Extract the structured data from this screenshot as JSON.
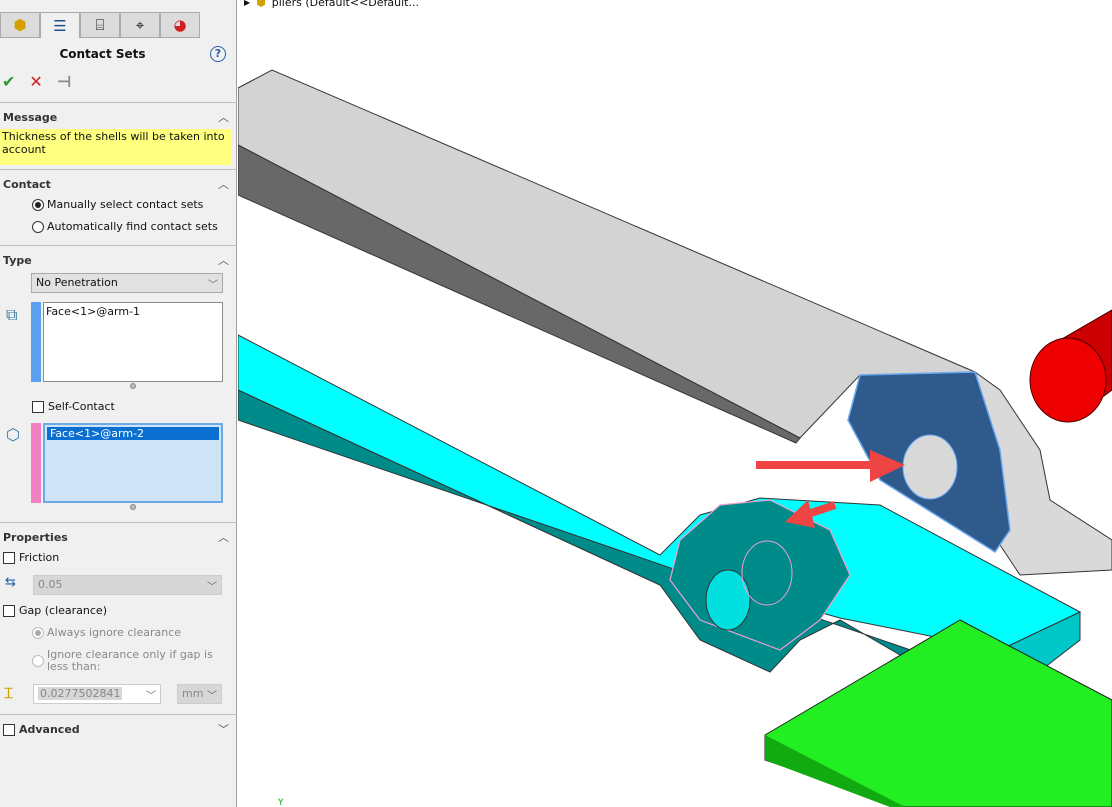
{
  "panel": {
    "tabs": [
      "part-icon",
      "property-manager-icon",
      "configuration-manager-icon",
      "dim-xpert-icon",
      "display-manager-icon"
    ],
    "title": "Contact Sets",
    "help": "?",
    "ok": "✔",
    "cancel": "✕",
    "pin": "⊣",
    "message": {
      "header": "Message",
      "text": "Thickness of the shells will be taken into account"
    },
    "contact": {
      "header": "Contact",
      "options": [
        "Manually select contact sets",
        "Automatically find contact sets"
      ],
      "selected": 0
    },
    "type": {
      "header": "Type",
      "value": "No Penetration",
      "set1": [
        "Face<1>@arm-1"
      ],
      "self_contact": "Self-Contact",
      "set2": [
        "Face<1>@arm-2"
      ],
      "set1_color": "#5aa0f0",
      "set2_color": "#f080c0"
    },
    "properties": {
      "header": "Properties",
      "friction": "Friction",
      "friction_value": "0.05",
      "gap": "Gap (clearance)",
      "gap_options": [
        "Always ignore clearance",
        "Ignore clearance only if gap is less than:"
      ],
      "gap_value": "0.0277502841",
      "unit": "mm"
    },
    "advanced": "Advanced"
  },
  "tree": {
    "label": "pliers  (Default<<Default..."
  },
  "viewport": {
    "axis_label": "Y"
  }
}
